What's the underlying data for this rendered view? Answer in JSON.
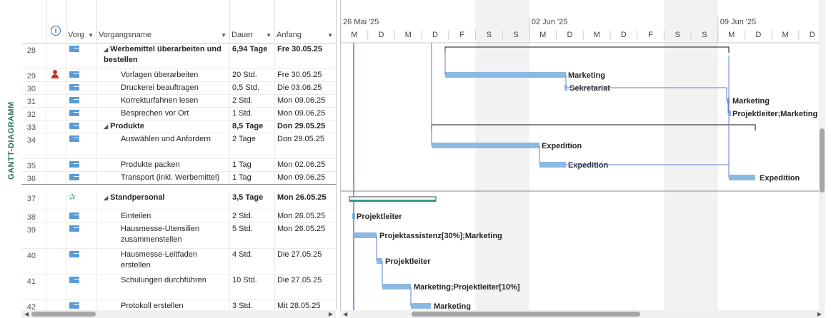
{
  "side_label": "GANTT-DIAGRAMM",
  "columns": {
    "info": "i",
    "mode": "Vorg",
    "name": "Vorgangsname",
    "duration": "Dauer",
    "start": "Anfang"
  },
  "timeline": {
    "weeks": [
      "26 Mai '25",
      "02 Jun '25",
      "09 Jun '25"
    ],
    "days": [
      "M",
      "D",
      "M",
      "D",
      "F",
      "S",
      "S",
      "M",
      "D",
      "M",
      "D",
      "F",
      "S",
      "S",
      "M",
      "D",
      "M",
      "D"
    ]
  },
  "rows": [
    {
      "id": "28",
      "name": "Werbemittel überarbeiten und bestellen",
      "duration": "6,94 Tage",
      "start": "Fre 30.05.25",
      "summary": true,
      "icon": "task",
      "indent": 1
    },
    {
      "id": "29",
      "name": "Vorlagen überarbeiten",
      "duration": "20 Std.",
      "start": "Fre 30.05.25",
      "summary": false,
      "icon": "task",
      "indent": 2,
      "person": true
    },
    {
      "id": "30",
      "name": "Druckerei beauftragen",
      "duration": "0,5 Std.",
      "start": "Die 03.06.25",
      "summary": false,
      "icon": "task",
      "indent": 2
    },
    {
      "id": "31",
      "name": "Korrekturfahnen lesen",
      "duration": "2 Std.",
      "start": "Mon 09.06.25",
      "summary": false,
      "icon": "task",
      "indent": 2
    },
    {
      "id": "32",
      "name": "Besprechen vor Ort",
      "duration": "1 Std.",
      "start": "Mon 09.06.25",
      "summary": false,
      "icon": "task",
      "indent": 2
    },
    {
      "id": "33",
      "name": "Produkte",
      "duration": "8,5 Tage",
      "start": "Don 29.05.25",
      "summary": true,
      "icon": "task",
      "indent": 1
    },
    {
      "id": "34",
      "name": "Auswählen und Anfordern",
      "duration": "2 Tage",
      "start": "Don 29.05.25",
      "summary": false,
      "icon": "task",
      "indent": 2
    },
    {
      "id": "35",
      "name": "Produkte packen",
      "duration": "1 Tag",
      "start": "Mon 02.06.25",
      "summary": false,
      "icon": "task",
      "indent": 2
    },
    {
      "id": "36",
      "name": "Transport (inkl. Werbemittel)",
      "duration": "1 Tag",
      "start": "Mon 09.06.25",
      "summary": false,
      "icon": "task",
      "indent": 2
    },
    {
      "id": "37",
      "name": "Standpersonal",
      "duration": "3,5 Tage",
      "start": "Mon 26.05.25",
      "summary": true,
      "icon": "pin",
      "indent": 1
    },
    {
      "id": "38",
      "name": "Einteilen",
      "duration": "2 Std.",
      "start": "Mon 26.05.25",
      "summary": false,
      "icon": "task",
      "indent": 2
    },
    {
      "id": "39",
      "name": "Hausmesse-Utensilien zusammenstellen",
      "duration": "5 Std.",
      "start": "Mon 26.05.25",
      "summary": false,
      "icon": "task",
      "indent": 2
    },
    {
      "id": "40",
      "name": "Hausmesse-Leitfaden erstellen",
      "duration": "4 Std.",
      "start": "Die 27.05.25",
      "summary": false,
      "icon": "task",
      "indent": 2
    },
    {
      "id": "41",
      "name": "Schulungen durchführen",
      "duration": "10 Std.",
      "start": "Die 27.05.25",
      "summary": false,
      "icon": "task",
      "indent": 2
    },
    {
      "id": "42",
      "name": "Protokoll erstellen",
      "duration": "3 Std.",
      "start": "Mit 28.05.25",
      "summary": false,
      "icon": "task",
      "indent": 2
    }
  ],
  "bar_labels": {
    "r29": "Marketing",
    "r30": "Sekretariat",
    "r31": "Marketing",
    "r32": "Projektleiter;Marketing",
    "r34": "Expedition",
    "r35": "Expedition",
    "r36": "Expedition",
    "r38": "Projektleiter",
    "r39": "Projektassistenz[30%];Marketing",
    "r40": "Projektleiter",
    "r41": "Marketing;Projektleiter[10%]",
    "r42": "Marketing"
  },
  "colors": {
    "task_bar": "#8cb8e4",
    "summary_line": "#404040",
    "accent_green": "#217346",
    "weekend": "#f2f2f2"
  }
}
